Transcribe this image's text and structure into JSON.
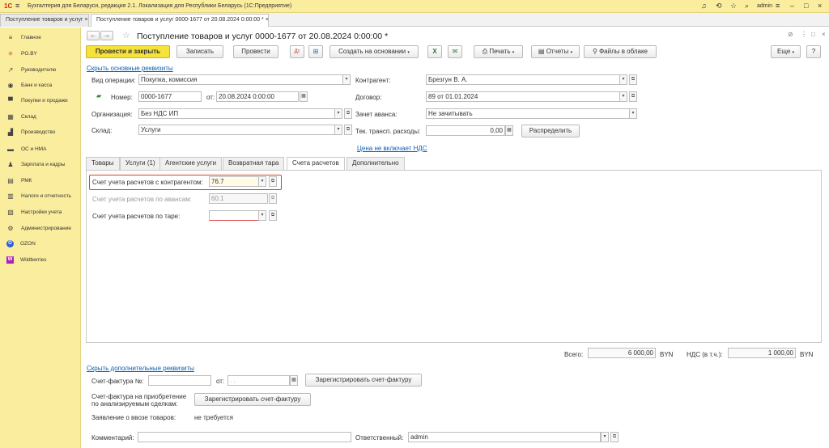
{
  "window_title": "Бухгалтерия для Беларуси, редакция 2.1. Локализация для Республики Беларусь   (1С:Предприятие)",
  "user": "admin",
  "open_tabs": [
    "Поступление товаров и услуг",
    "Поступление товаров и услуг 0000-1677 от 20.08.2024 0:00:00 *"
  ],
  "sidebar": [
    {
      "label": "Главное",
      "icon": "menu-icon",
      "glyph": "≡"
    },
    {
      "label": "PO.BY",
      "icon": "sun-icon",
      "glyph": "✳"
    },
    {
      "label": "Руководителю",
      "icon": "trend-icon",
      "glyph": "↗"
    },
    {
      "label": "Банк и касса",
      "icon": "bank-icon",
      "glyph": "◉"
    },
    {
      "label": "Покупки и продажи",
      "icon": "cart-icon",
      "glyph": "▀"
    },
    {
      "label": "Склад",
      "icon": "warehouse-icon",
      "glyph": "▦"
    },
    {
      "label": "Производство",
      "icon": "factory-icon",
      "glyph": "▟"
    },
    {
      "label": "ОС и НМА",
      "icon": "truck-icon",
      "glyph": "▬"
    },
    {
      "label": "Зарплата и кадры",
      "icon": "people-icon",
      "glyph": "♟"
    },
    {
      "label": "РМК",
      "icon": "register-icon",
      "glyph": "▤"
    },
    {
      "label": "Налоги и отчетность",
      "icon": "chart-icon",
      "glyph": "▥"
    },
    {
      "label": "Настройки учета",
      "icon": "settings-icon",
      "glyph": "▧"
    },
    {
      "label": "Администрирование",
      "icon": "gear-icon",
      "glyph": "⚙"
    },
    {
      "label": "OZON",
      "icon": "ozon-icon",
      "glyph": "O"
    },
    {
      "label": "Wildberries",
      "icon": "wildberries-icon",
      "glyph": "W"
    }
  ],
  "doc": {
    "title": "Поступление товаров и услуг 0000-1677 от 20.08.2024 0:00:00 *",
    "toolbar": {
      "post_close": "Провести и закрыть",
      "save": "Записать",
      "post": "Провести",
      "create_based": "Создать на основании",
      "print": "Печать",
      "reports": "Отчеты",
      "cloud_files": "Файлы в облаке",
      "more": "Еще",
      "help": "?"
    },
    "hide_main": "Скрыть основные реквизиты",
    "operation_label": "Вид операции:",
    "operation": "Покупка, комиссия",
    "number_label": "Номер:",
    "number": "0000-1677",
    "date_label": "от:",
    "date": "20.08.2024  0:00:00",
    "org_label": "Организация:",
    "org": "Без НДС ИП",
    "warehouse_label": "Склад:",
    "warehouse": "Услуги",
    "contractor_label": "Контрагент:",
    "contractor": "Брезгун В. А.",
    "contract_label": "Договор:",
    "contract": "89 от 01.01.2024",
    "advance_label": "Зачет аванса:",
    "advance": "Не зачитывать",
    "transport_label": "Тек. трансп. расходы:",
    "transport": "0,00",
    "distribute": "Распределить",
    "vat_link": "Цена не включает НДС",
    "tabs": [
      "Товары",
      "Услуги (1)",
      "Агентские услуги",
      "Возвратная тара",
      "Счета расчетов",
      "Дополнительно"
    ],
    "accounts": {
      "contractor_label": "Счет учета расчетов с контрагентом:",
      "contractor_value": "76.7",
      "advance_label": "Счет учета расчетов по авансам:",
      "advance_value": "60.1",
      "tare_label": "Счет учета расчетов по таре:",
      "tare_value": ""
    },
    "total_label": "Всего:",
    "total": "6 000,00",
    "currency": "BYN",
    "vat_label": "НДС (в т.ч.):",
    "vat": "1 000,00",
    "vat_currency": "BYN",
    "hide_extra": "Скрыть дополнительные реквизиты",
    "invoice_label": "Счет-фактура №:",
    "invoice_date_label": "от:",
    "invoice_date_placeholder": " .  .",
    "register_invoice": "Зарегистрировать счет-фактуру",
    "purchase_invoice_label1": "Счет-фактура на приобретение",
    "purchase_invoice_label2": "по анализируемым сделкам:",
    "import_label": "Заявление о ввозе товаров:",
    "import_value": "не требуется",
    "comment_label": "Комментарий:",
    "responsible_label": "Ответственный:",
    "responsible": "admin"
  },
  "colors": {
    "accent": "#f5e23a",
    "highlight_border": "#d9421f",
    "link": "#0a5fad"
  }
}
